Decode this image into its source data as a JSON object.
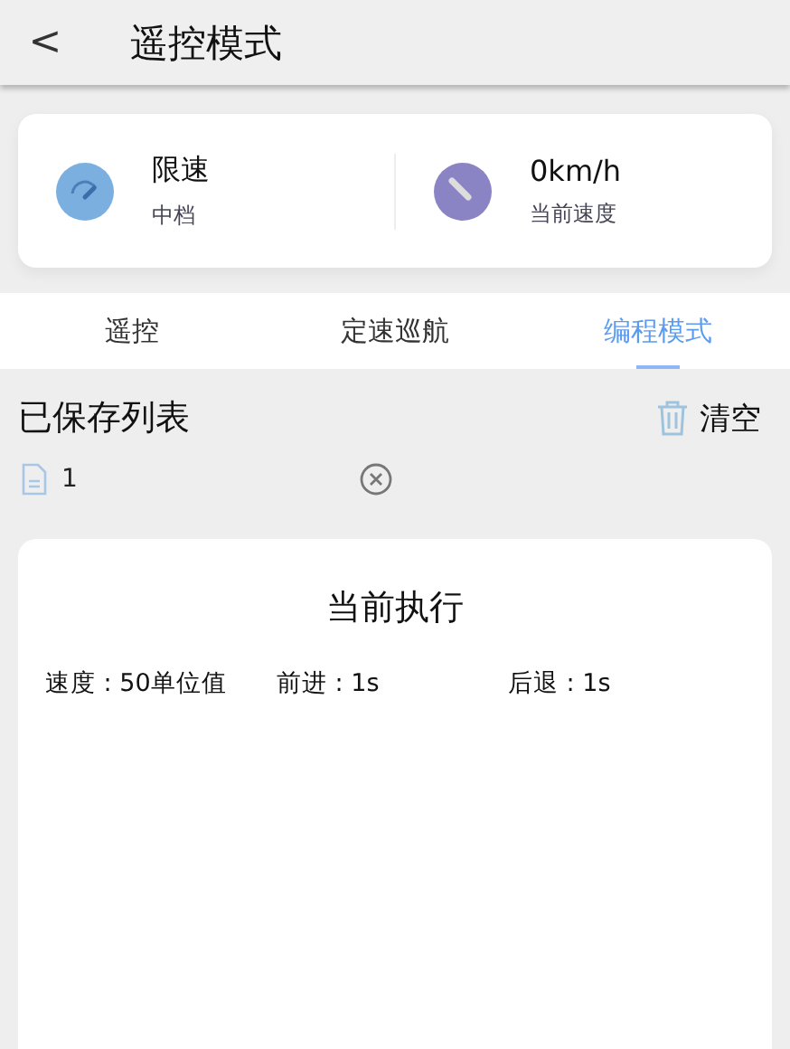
{
  "header": {
    "back": "<",
    "title": "遥控模式"
  },
  "stats": [
    {
      "kind": "gauge",
      "color": "#7aafe0",
      "value": "限速",
      "label": "中档"
    },
    {
      "kind": "dial",
      "color": "#8a84c4",
      "value": "0km/h",
      "label": "当前速度"
    }
  ],
  "tabs": [
    {
      "label": "遥控",
      "selected": false
    },
    {
      "label": "定速巡航",
      "selected": false
    },
    {
      "label": "编程模式",
      "selected": true
    }
  ],
  "saved": {
    "title": "已保存列表",
    "clear": "清空",
    "items": [
      {
        "name": "1"
      }
    ]
  },
  "current": {
    "title": "当前执行",
    "fields": [
      "速度 : 50单位值",
      "前进 : 1s",
      "后退 : 1s"
    ]
  }
}
